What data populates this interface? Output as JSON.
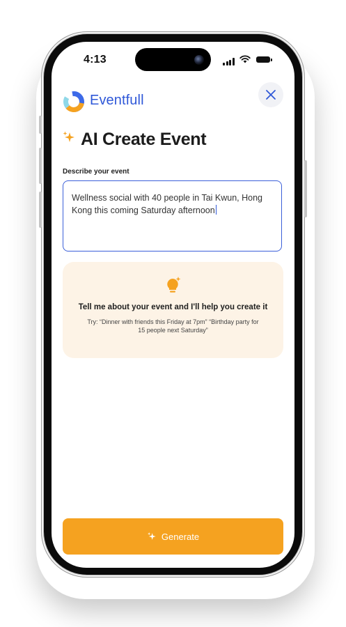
{
  "status_bar": {
    "time": "4:13"
  },
  "app": {
    "brand_name": "Eventfull"
  },
  "header": {
    "title": "AI Create Event",
    "close_icon": "close-icon",
    "title_icon": "sparkle-icon"
  },
  "form": {
    "label": "Describe your event",
    "value": "Wellness social with 40 people in Tai Kwun, Hong Kong this coming Saturday afternoon"
  },
  "hint": {
    "icon": "lightbulb-icon",
    "title": "Tell me about your event and I'll help you create it",
    "body": "Try: “Dinner with friends this Friday at 7pm” “Birthday party for 15 people next Saturday”"
  },
  "actions": {
    "generate_label": "Generate",
    "generate_icon": "sparkle-icon"
  },
  "colors": {
    "accent": "#f5a220",
    "brand": "#2f58d8",
    "hint_background": "#fdf3e6"
  }
}
